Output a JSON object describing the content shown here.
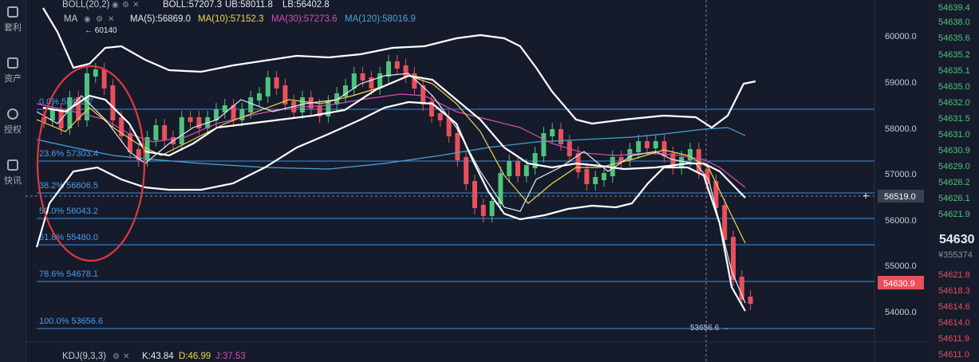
{
  "sidebar": {
    "items": [
      {
        "label": "套利",
        "icon": "arbitrage-icon"
      },
      {
        "label": "资产",
        "icon": "assets-icon"
      },
      {
        "label": "授权",
        "icon": "key-icon"
      },
      {
        "label": "快讯",
        "icon": "news-icon"
      }
    ]
  },
  "indicators": {
    "boll": {
      "label": "BOLL(20,2)",
      "boll": "BOLL:57207.3",
      "ub": "UB:58011.8",
      "lb": "LB:56402.8"
    },
    "ma": {
      "label": "MA",
      "ma5": "MA(5):56869.0",
      "ma10": "MA(10):57152.3",
      "ma30": "MA(30):57273.6",
      "ma120": "MA(120):58016.9"
    },
    "kdj": {
      "label": "KDJ(9,3,3)",
      "k": "K:43.84",
      "d": "D:46.99",
      "j": "J:37.53"
    }
  },
  "annotations": {
    "high_marker": "← 60140",
    "low_marker": "53656.6 →"
  },
  "axis": {
    "labels": [
      "60000.0",
      "59000.0",
      "58000.0",
      "57000.0",
      "56000.0",
      "55000.0",
      "54000.0"
    ],
    "crosshair_price": "56519.0",
    "current_price": "54630.9"
  },
  "fib_levels": [
    {
      "label": "0.0% 58422.7"
    },
    {
      "label": "23.6% 57303.4"
    },
    {
      "label": "38.2% 56606.5"
    },
    {
      "label": "50.0% 56043.2"
    },
    {
      "label": "61.8% 55480.0"
    },
    {
      "label": "78.6% 54678.1"
    },
    {
      "label": "100.0% 53656.6"
    }
  ],
  "orderbook": {
    "asks": [
      "54639.4",
      "54638.0",
      "54635.6",
      "54635.2",
      "54635.1",
      "54635.0",
      "54632.0",
      "54631.5",
      "54631.0",
      "54630.9",
      "54629.0",
      "54626.2",
      "54626.1",
      "54621.9"
    ],
    "last_price": "54630",
    "last_cny": "¥355374",
    "bids": [
      "54621.8",
      "54618.3",
      "54614.6",
      "54614.0",
      "54611.9",
      "54611.0"
    ]
  },
  "colors": {
    "background": "#151b2b",
    "up": "#4fc37d",
    "down": "#e8505b",
    "fib_line": "#3d8ee6",
    "ma5": "#ffffff",
    "ma10": "#f2d64a",
    "ma30": "#d84fb1",
    "ma120": "#4aa3d8",
    "highlight_circle": "#e0383d"
  }
}
